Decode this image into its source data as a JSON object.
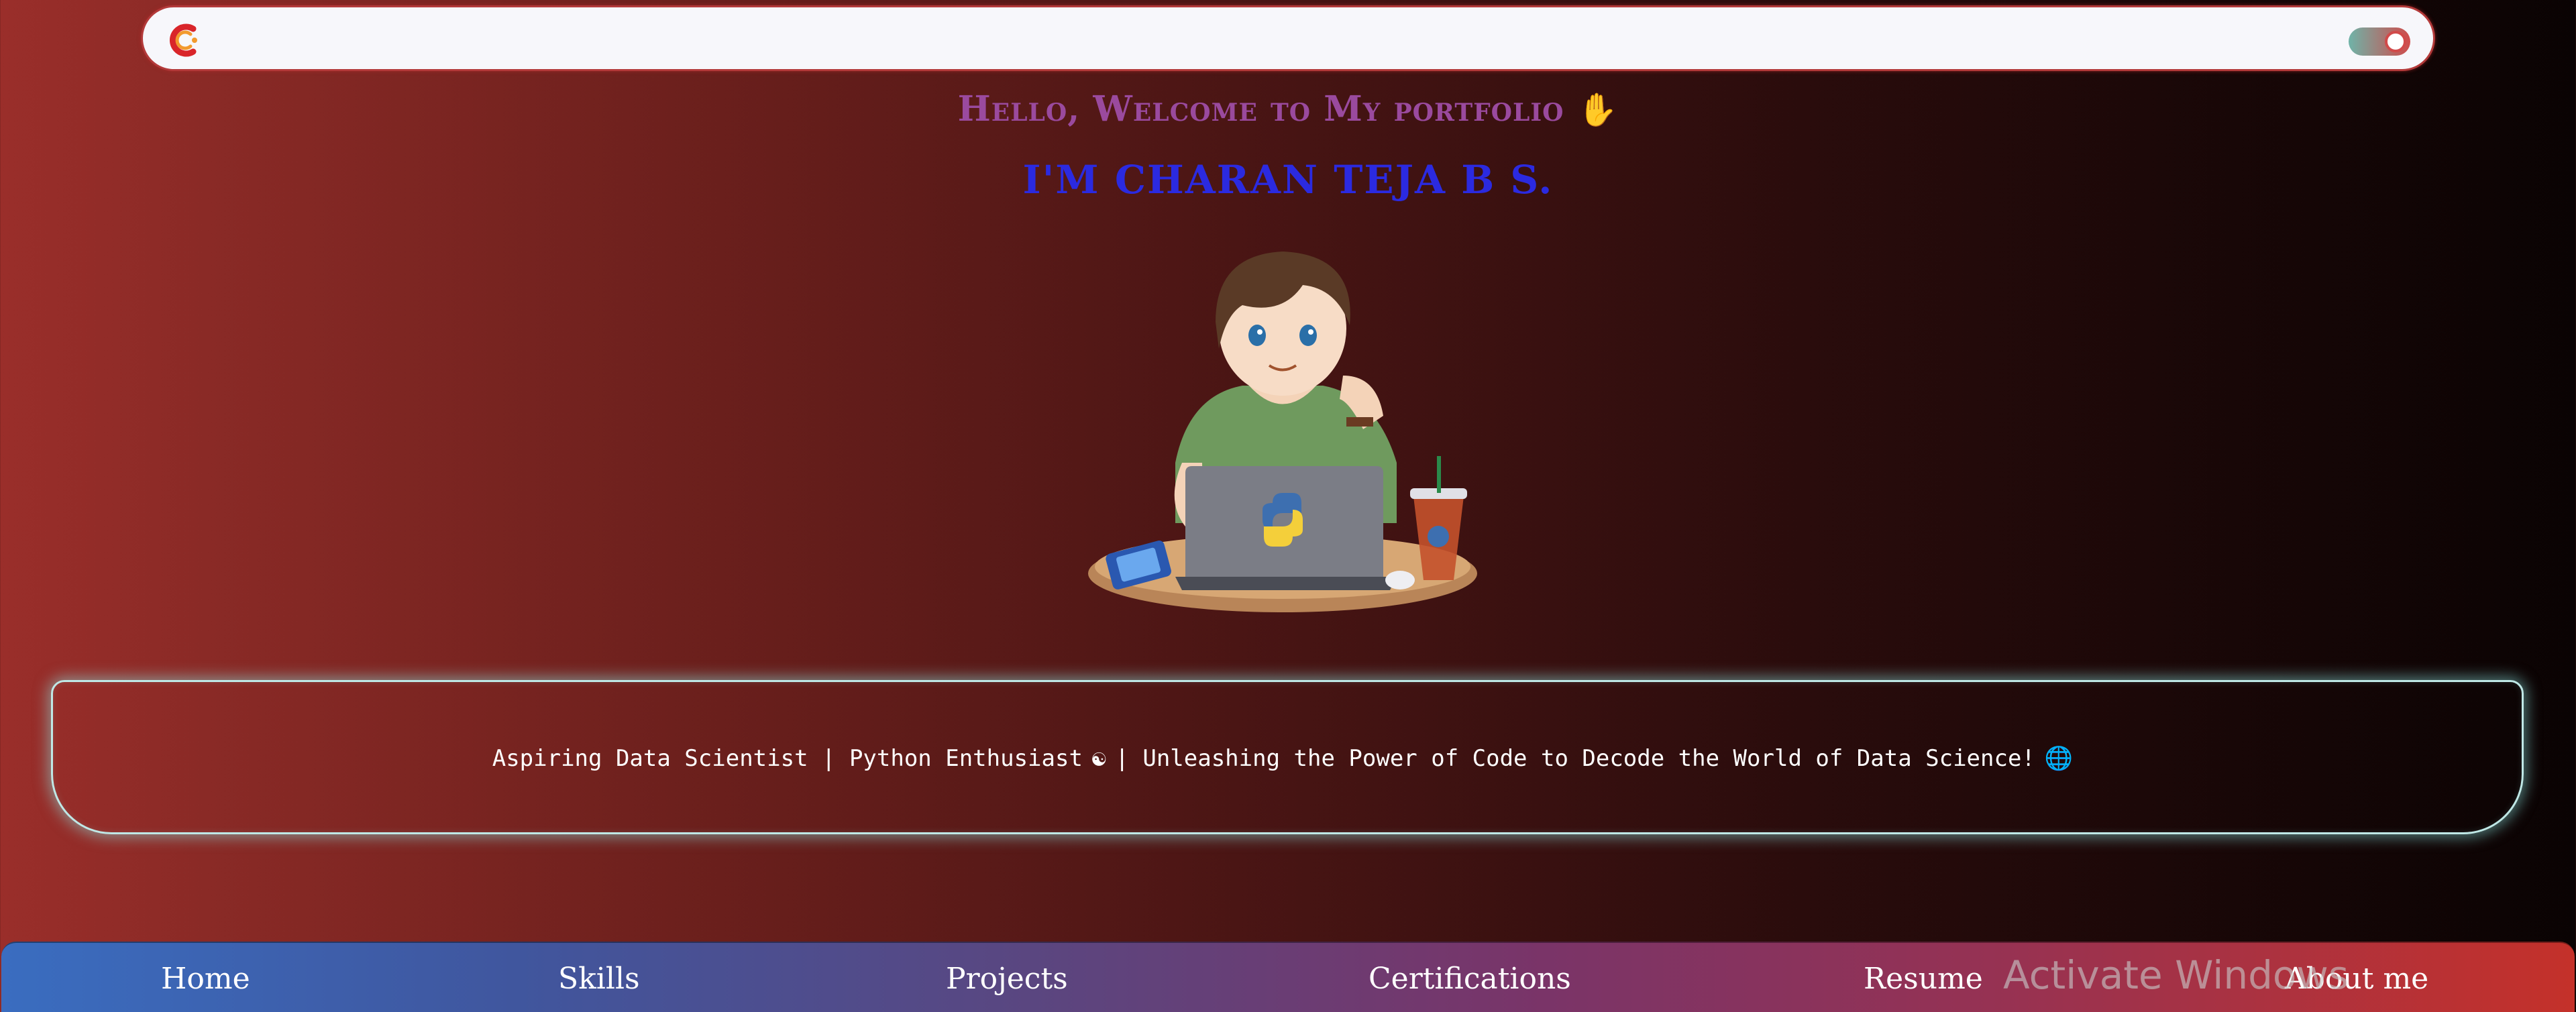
{
  "header": {
    "logo_icon": "logo-c-icon",
    "theme_toggle_icon": "theme-toggle-icon"
  },
  "hero": {
    "greeting": "Hello, Welcome to My portfolio",
    "greeting_emoji": "✋",
    "name": "I'M CHARAN TEJA B S.",
    "avatar_icon": "developer-avatar-illustration"
  },
  "tagline": {
    "part1": "Aspiring Data Scientist | Python Enthusiast",
    "icon1": "☯",
    "part2": "| Unleashing the Power of Code to Decode the World of Data Science!",
    "icon2": "🌐"
  },
  "nav": {
    "items": [
      {
        "label": "Home"
      },
      {
        "label": "Skills"
      },
      {
        "label": "Projects"
      },
      {
        "label": "Certifications"
      },
      {
        "label": "Resume"
      },
      {
        "label": "About me"
      }
    ]
  },
  "os_watermark": "Activate Windows",
  "colors": {
    "greeting": "#9a4a9e",
    "name": "#2b2ae0",
    "glow": "#bfe8e6"
  }
}
